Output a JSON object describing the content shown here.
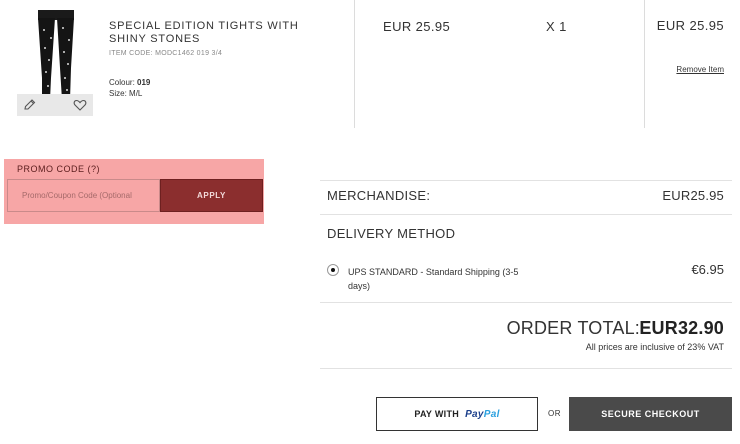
{
  "cart_item": {
    "name": "SPECIAL EDITION TIGHTS WITH SHINY STONES",
    "item_code": "ITEM CODE:  MODC1462 019 3/4",
    "colour_label": "Colour:",
    "colour_value": "019",
    "size_label": "Size:",
    "size_value": "M/L",
    "unit_price": "EUR 25.95",
    "quantity": "X 1",
    "line_total": "EUR 25.95",
    "remove_label": "Remove Item",
    "actions": [
      "edit-icon",
      "heart-icon"
    ]
  },
  "promo": {
    "label": "PROMO CODE  (?)",
    "placeholder": "Promo/Coupon Code (Optional",
    "apply_label": "APPLY"
  },
  "summary": {
    "merchandise_label": "MERCHANDISE:",
    "merchandise_value": "EUR25.95",
    "delivery_label": "DELIVERY METHOD",
    "shipping_option": "UPS STANDARD - Standard Shipping (3-5 days)",
    "shipping_price": "€6.95",
    "order_total_label": "ORDER TOTAL:",
    "order_total_value": "EUR32.90",
    "vat_note": "All prices are inclusive of 23% VAT"
  },
  "checkout": {
    "paypal_label": "PAY WITH",
    "paypal_logo_1": "Pay",
    "paypal_logo_2": "Pal",
    "or_label": "OR",
    "secure_checkout_label": "SECURE CHECKOUT"
  },
  "colors": {
    "promo_highlight": "#f7a6a6",
    "apply_button": "#8b2e2e",
    "checkout_button": "#4a4a4a",
    "paypal_dark": "#1b3f8b",
    "paypal_light": "#2aa0df"
  }
}
